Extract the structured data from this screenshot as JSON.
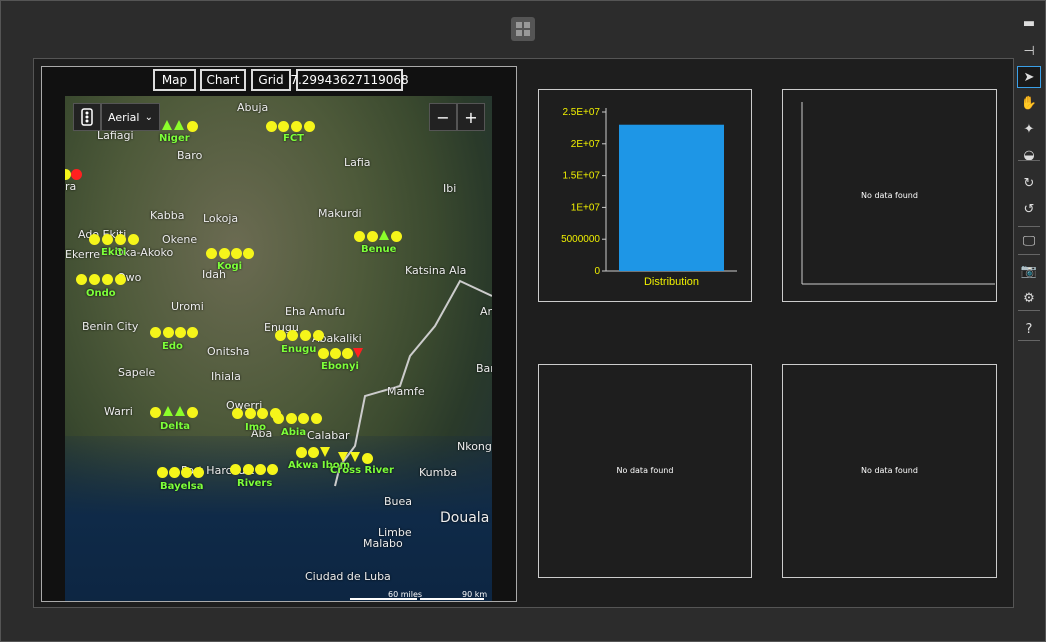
{
  "window": {
    "logo_icon": "windows-logo-icon"
  },
  "toolbar": {
    "items": [
      {
        "name": "minimize-icon",
        "glyph": "▬"
      },
      {
        "name": "pin-icon",
        "glyph": "⊣"
      },
      {
        "name": "select-arrow-icon",
        "glyph": "➤"
      },
      {
        "name": "hand-pan-icon",
        "glyph": "✋"
      },
      {
        "name": "zoom-stars-icon",
        "glyph": "✦"
      },
      {
        "name": "rotate-3d-icon",
        "glyph": "◒"
      },
      {
        "name": "rotate-cw-icon",
        "glyph": "↻"
      },
      {
        "name": "rotate-ccw-icon",
        "glyph": "↺"
      },
      {
        "name": "monitor-icon",
        "glyph": "🖵"
      },
      {
        "name": "camera-icon",
        "glyph": "📷"
      },
      {
        "name": "gear-icon",
        "glyph": "⚙"
      },
      {
        "name": "help-icon",
        "glyph": "?"
      }
    ]
  },
  "view_buttons": {
    "map": "Map",
    "chart": "Chart",
    "grid": "Grid",
    "value": "7.29943627119068"
  },
  "map": {
    "style_dropdown": "Aerial",
    "zoom_out": "−",
    "zoom_in": "+",
    "scale_miles": "60 miles",
    "scale_km": "90 km",
    "places": [
      "Abuja",
      "Lafiagi",
      "Baro",
      "Lafia",
      "Ibi",
      "Kabba",
      "Lokoja",
      "Makurdi",
      "Ado Ekiti",
      "Okene",
      "Oka-Akoko",
      "Idah",
      "Katsina Ala",
      "Owo",
      "Uromi",
      "Eha Amufu",
      "Ar",
      "Benin City",
      "Enugu",
      "Abakaliki",
      "Onitsha",
      "Sapele",
      "Ihiala",
      "Bar",
      "Mamfe",
      "Warri",
      "Owerri",
      "Aba",
      "Calabar",
      "Nkong",
      "Port Harcourt",
      "Kumba",
      "Buea",
      "Limbe",
      "Douala",
      "Malabo",
      "Ciudad de Luba",
      "ra",
      "Ekerre"
    ],
    "states": [
      "Niger",
      "FCT",
      "Benue",
      "Ekiti",
      "Kogi",
      "Ondo",
      "Edo",
      "Enugu",
      "Ebonyi",
      "Delta",
      "Imo",
      "Abia",
      "Akwa Ibom",
      "Cross River",
      "Bayelsa",
      "Rivers"
    ]
  },
  "chart_data": [
    {
      "type": "bar",
      "categories": [
        "Distribution"
      ],
      "values": [
        23000000
      ],
      "ylim": [
        0,
        25000000
      ],
      "yticks": [
        "2.5E+07",
        "2E+07",
        "1.5E+07",
        "1E+07",
        "5000000",
        "0"
      ],
      "bar_color": "#1e96e6",
      "tick_color": "#f0f000"
    }
  ],
  "empty_charts": {
    "message": "No data found"
  }
}
